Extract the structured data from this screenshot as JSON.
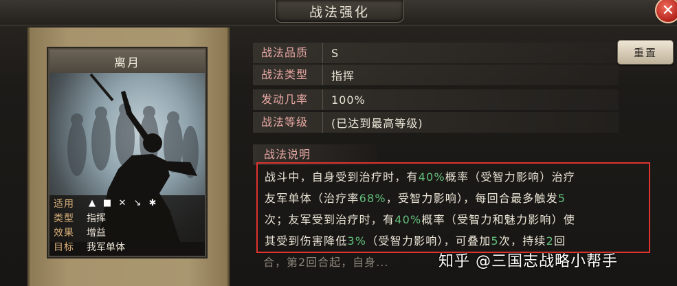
{
  "window": {
    "title": "战法强化",
    "close_glyph": "✕"
  },
  "card": {
    "name": "离月",
    "rows": {
      "applicable_label": "适用",
      "type_label": "类型",
      "type_value": "指挥",
      "effect_label": "效果",
      "effect_value": "增益",
      "target_label": "目标",
      "target_value": "我军单体"
    },
    "troop_icons": [
      "cavalry-icon",
      "shield-icon",
      "bow-icon",
      "spear-icon",
      "wheel-icon"
    ]
  },
  "properties": [
    {
      "label": "战法品质",
      "value": "S"
    },
    {
      "label": "战法类型",
      "value": "指挥"
    },
    {
      "label": "发动几率",
      "value": "100%"
    },
    {
      "label": "战法等级",
      "value": "(已达到最高等级)"
    }
  ],
  "reset_button": "重置",
  "description": {
    "label": "战法说明",
    "lines": [
      [
        {
          "t": "战斗中，自身受到治疗时，有"
        },
        {
          "t": "40%",
          "g": true
        },
        {
          "t": "概率（受智力影响）治疗"
        }
      ],
      [
        {
          "t": "友军单体（治疗率"
        },
        {
          "t": "68%",
          "g": true
        },
        {
          "t": "，受智力影响），每回合最多触发"
        },
        {
          "t": "5",
          "g": true
        }
      ],
      [
        {
          "t": "次；友军受到治疗时，有"
        },
        {
          "t": "40%",
          "g": true
        },
        {
          "t": "概率（受智力和魅力影响）使"
        }
      ],
      [
        {
          "t": "其受到伤害降低"
        },
        {
          "t": "3%",
          "g": true
        },
        {
          "t": "（受智力影响），可叠加"
        },
        {
          "t": "5",
          "g": true
        },
        {
          "t": "次，持续"
        },
        {
          "t": "2",
          "g": true
        },
        {
          "t": "回"
        }
      ]
    ],
    "tail": "合，第2回合起，自身..."
  },
  "watermark": "知乎 @三国志战略小帮手",
  "colors": {
    "highlight": "#63c07e",
    "label": "#e9a9a4",
    "frame": "#e0332f"
  }
}
